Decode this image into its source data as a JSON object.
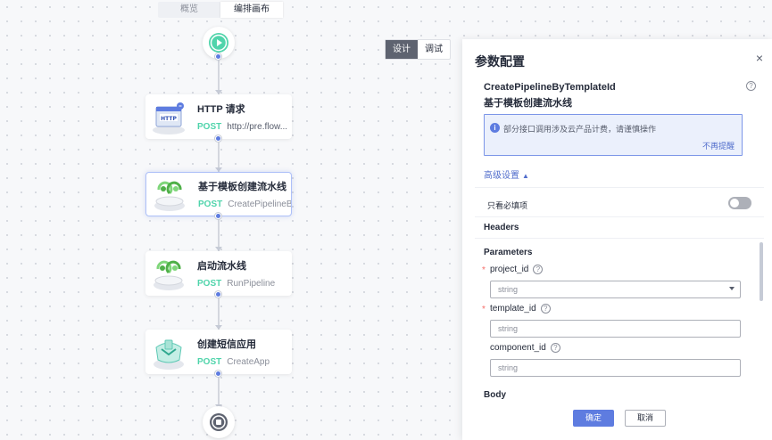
{
  "tabs": [
    {
      "label": "概览",
      "active": false
    },
    {
      "label": "编排画布",
      "active": true
    }
  ],
  "mode_toggle": {
    "design": "设计",
    "debug": "调试"
  },
  "nodes": [
    {
      "title": "HTTP 请求",
      "method": "POST",
      "endpoint": "http://pre.flow...",
      "icon": "http-request-icon"
    },
    {
      "title": "基于模板创建流水线",
      "method": "POST",
      "endpoint": "CreatePipelineB...",
      "icon": "pipeline-icon",
      "selected": true
    },
    {
      "title": "启动流水线",
      "method": "POST",
      "endpoint": "RunPipeline",
      "icon": "pipeline-icon"
    },
    {
      "title": "创建短信应用",
      "method": "POST",
      "endpoint": "CreateApp",
      "icon": "sms-app-icon"
    }
  ],
  "panel": {
    "title": "参数配置",
    "close": "×",
    "api_name": "CreatePipelineByTemplateId",
    "api_desc": "基于模板创建流水线",
    "help": "?",
    "notice": {
      "icon": "i",
      "text": "部分接口调用涉及云产品计费，请谨慎操作",
      "link": "不再提醒"
    },
    "advanced": "高级设置",
    "required_only": "只看必填项",
    "headers": "Headers",
    "parameters": "Parameters",
    "fields": [
      {
        "name": "project_id",
        "required": true,
        "type": "select",
        "value": "string"
      },
      {
        "name": "template_id",
        "required": true,
        "type": "input",
        "placeholder": "string"
      },
      {
        "name": "component_id",
        "required": false,
        "type": "input",
        "placeholder": "string"
      }
    ],
    "body": "Body",
    "ok": "确定",
    "cancel": "取消"
  },
  "colors": {
    "accent": "#5e7ce0",
    "post": "#50d4ab",
    "start": "#50d4ab",
    "end": "#5e6370"
  }
}
